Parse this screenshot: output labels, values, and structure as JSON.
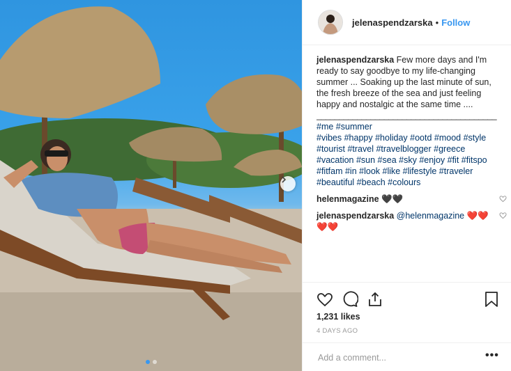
{
  "header": {
    "username": "jelenaspendzarska",
    "separator": "•",
    "follow_label": "Follow"
  },
  "caption": {
    "username": "jelenaspendzarska",
    "lines": [
      "Few more days and I'm",
      "ready to say goodbye to my life-changing",
      "summer ... Soaking up the last minute of sun,",
      "the fresh breeze of the sea and just feeling",
      "happy and nostalgic at the same time ....",
      "________________________________________"
    ],
    "hashtag_lines": [
      "#me #summer",
      "#vibes #happy #holiday #ootd #mood #style",
      "#tourist #travel #travelblogger #greece",
      "#vacation #sun #sea #sky #enjoy #fit #fitspo",
      "#fitfam #in #look #like #lifestyle #traveler",
      "#beautiful #beach #colours"
    ]
  },
  "comments": [
    {
      "username": "helenmagazine",
      "text": "🖤🖤"
    },
    {
      "username": "jelenaspendzarska",
      "mention": "@helenmagazine",
      "hearts1": "❤️❤️",
      "hearts2": "❤️❤️"
    }
  ],
  "stats": {
    "likes": "1,231 likes",
    "time": "4 DAYS AGO"
  },
  "add_comment": {
    "placeholder": "Add a comment...",
    "more_label": "•••"
  },
  "carousel": {
    "total": 2,
    "active": 1
  },
  "colors": {
    "accent": "#3897f0",
    "hashtag": "#003569",
    "text": "#262626",
    "muted": "#999999"
  },
  "icons": [
    "heart-icon",
    "comment-icon",
    "share-icon",
    "bookmark-icon",
    "chevron-right-icon"
  ]
}
